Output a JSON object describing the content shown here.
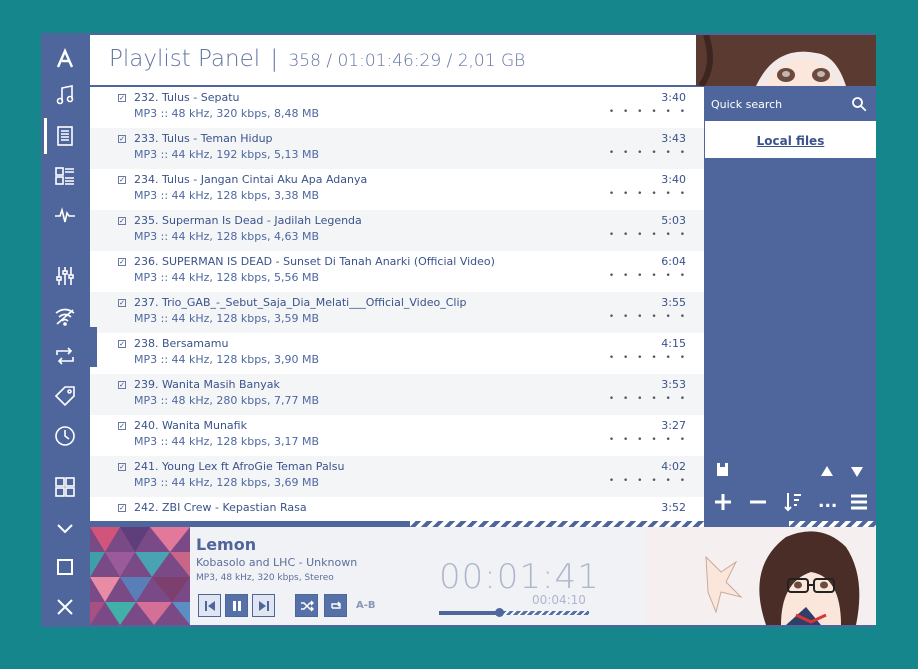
{
  "header": {
    "title": "Playlist Panel",
    "separator": "|",
    "stats": "358 / 01:01:46:29 / 2,01 GB"
  },
  "sidebar": {
    "icons": [
      "aimp-logo-icon",
      "music-note-icon",
      "playlist-icon",
      "library-icon",
      "waveform-icon",
      "equalizer-icon",
      "wifi-icon",
      "repeat-icon",
      "tag-icon",
      "clock-icon",
      "grid-icon",
      "chevron-down-icon",
      "window-icon",
      "close-icon"
    ]
  },
  "tracks": [
    {
      "title": "232. Tulus - Sepatu",
      "info": "MP3 :: 48 kHz, 320 kbps, 8,48 MB",
      "duration": "3:40"
    },
    {
      "title": "233. Tulus - Teman Hidup",
      "info": "MP3 :: 44 kHz, 192 kbps, 5,13 MB",
      "duration": "3:43"
    },
    {
      "title": "234. Tulus - Jangan Cintai Aku Apa Adanya",
      "info": "MP3 :: 44 kHz, 128 kbps, 3,38 MB",
      "duration": "3:40"
    },
    {
      "title": "235. Superman Is Dead - Jadilah Legenda",
      "info": "MP3 :: 44 kHz, 128 kbps, 4,63 MB",
      "duration": "5:03"
    },
    {
      "title": "236. SUPERMAN IS DEAD - Sunset Di Tanah Anarki (Official Video)",
      "info": "MP3 :: 44 kHz, 128 kbps, 5,56 MB",
      "duration": "6:04"
    },
    {
      "title": "237. Trio_GAB_-_Sebut_Saja_Dia_Melati___Official_Video_Clip",
      "info": "MP3 :: 44 kHz, 128 kbps, 3,59 MB",
      "duration": "3:55"
    },
    {
      "title": "238. Bersamamu",
      "info": "MP3 :: 44 kHz, 128 kbps, 3,90 MB",
      "duration": "4:15"
    },
    {
      "title": "239. Wanita Masih Banyak",
      "info": "MP3 :: 48 kHz, 280 kbps, 7,77 MB",
      "duration": "3:53"
    },
    {
      "title": "240. Wanita Munafik",
      "info": "MP3 :: 44 kHz, 128 kbps, 3,17 MB",
      "duration": "3:27"
    },
    {
      "title": "241. Young Lex ft AfroGie Teman Palsu",
      "info": "MP3 :: 44 kHz, 128 kbps, 3,69 MB",
      "duration": "4:02"
    },
    {
      "title": "242. ZBI Crew - Kepastian Rasa",
      "info": "",
      "duration": "3:52"
    }
  ],
  "rating_dots": "• • • • • •",
  "checkmark": "✓",
  "right_panel": {
    "search_label": "Quick search",
    "local_files": "Local files",
    "more_label": "..."
  },
  "player": {
    "title": "Lemon",
    "artist": "Kobasolo and LHC - Unknown",
    "info": "MP3, 48 kHz, 320 kbps, Stereo",
    "time": "00:01:41",
    "total": "00:04:10",
    "ab_label": "A-B",
    "progress": 0.4
  },
  "colors": {
    "accent": "#4e669c",
    "background": "#15868b",
    "text": "#3a538b"
  }
}
